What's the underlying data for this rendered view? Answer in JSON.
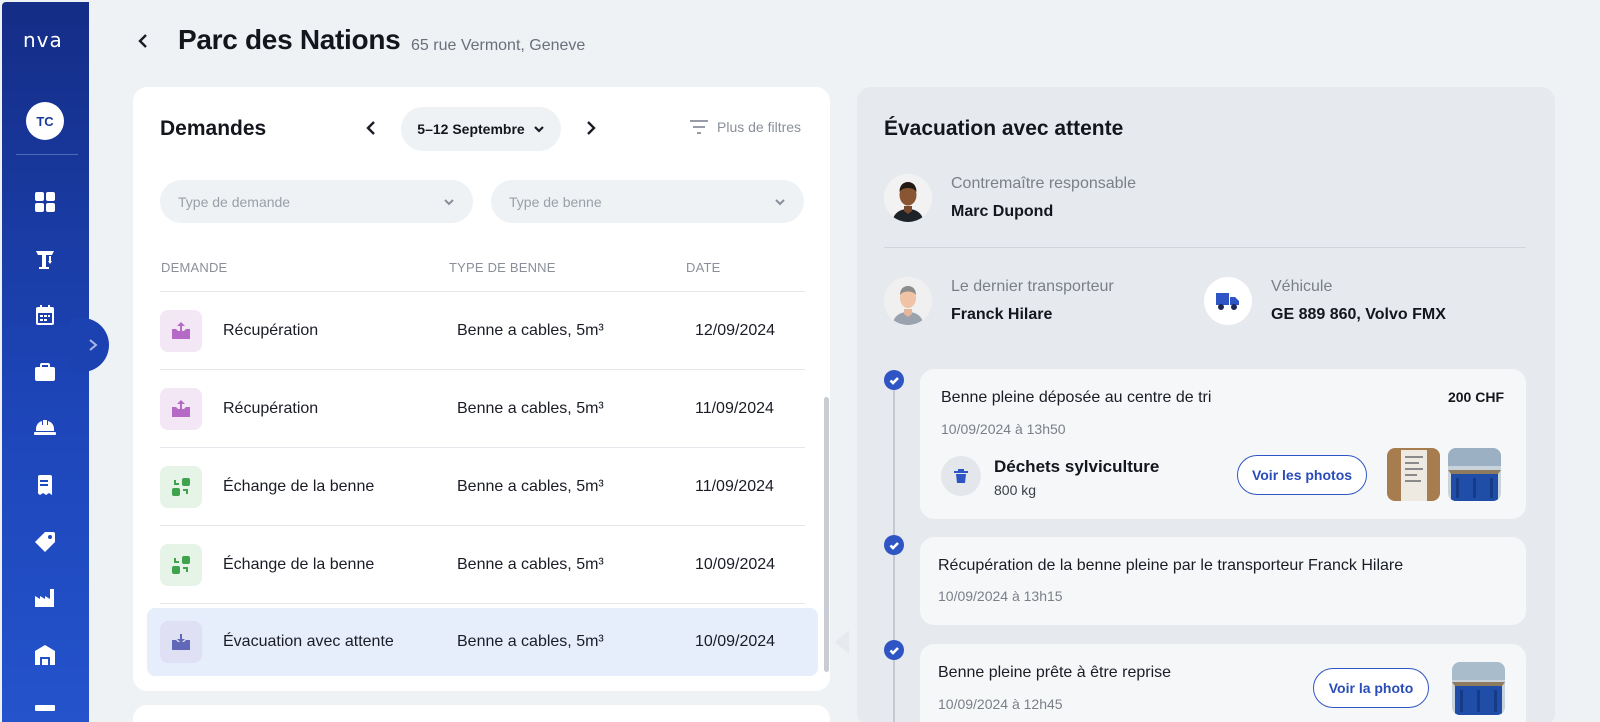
{
  "sidebar": {
    "logo": "nva",
    "user_initials": "TC",
    "nav_items": [
      {
        "icon": "dashboard-grid-icon"
      },
      {
        "icon": "crane-icon"
      },
      {
        "icon": "calendar-icon"
      },
      {
        "icon": "briefcase-icon"
      },
      {
        "icon": "hard-hat-icon"
      },
      {
        "icon": "receipt-icon"
      },
      {
        "icon": "price-tag-icon"
      },
      {
        "icon": "factory-icon"
      },
      {
        "icon": "warehouse-icon"
      }
    ]
  },
  "header": {
    "title": "Parc des Nations",
    "address": "65 rue Vermont, Geneve"
  },
  "requests": {
    "title": "Demandes",
    "week_label": "5–12 Septembre",
    "filters_label": "Plus de filtres",
    "filter_request_type_placeholder": "Type de demande",
    "filter_bin_type_placeholder": "Type de benne",
    "columns": [
      "DEMANDE",
      "TYPE DE BENNE",
      "DATE"
    ],
    "rows": [
      {
        "name": "Récupération",
        "bin": "Benne a cables, 5m³",
        "date": "12/09/2024",
        "kind": "pickup"
      },
      {
        "name": "Récupération",
        "bin": "Benne a cables, 5m³",
        "date": "11/09/2024",
        "kind": "pickup"
      },
      {
        "name": "Échange de la benne",
        "bin": "Benne a cables, 5m³",
        "date": "11/09/2024",
        "kind": "exchange"
      },
      {
        "name": "Échange de la benne",
        "bin": "Benne a cables, 5m³",
        "date": "10/09/2024",
        "kind": "exchange"
      },
      {
        "name": "Évacuation avec attente",
        "bin": "Benne a cables, 5m³",
        "date": "10/09/2024",
        "kind": "evacuation",
        "selected": true
      }
    ]
  },
  "detail": {
    "title": "Évacuation avec attente",
    "foreman_label": "Contremaître responsable",
    "foreman_name": "Marc Dupond",
    "carrier_label": "Le dernier transporteur",
    "carrier_name": "Franck Hilare",
    "vehicle_label": "Véhicule",
    "vehicle_value": "GE 889 860, Volvo FMX",
    "events": [
      {
        "title": "Benne pleine déposée au centre de tri",
        "time": "10/09/2024 à 13h50",
        "price": "200 CHF",
        "waste_name": "Déchets sylviculture",
        "waste_qty": "800 kg",
        "button": "Voir les photos"
      },
      {
        "title": "Récupération de la benne pleine par le transporteur  Franck Hilare",
        "time": "10/09/2024 à 13h15"
      },
      {
        "title": "Benne pleine prête à être reprise",
        "time": "10/09/2024 à 12h45",
        "button": "Voir la photo"
      }
    ]
  },
  "colors": {
    "sidebar_top": "#142d86",
    "sidebar_bottom": "#2453cc",
    "accent": "#2f55c4",
    "selected_row": "#e6eefb",
    "page_bg": "#eef2f5"
  }
}
